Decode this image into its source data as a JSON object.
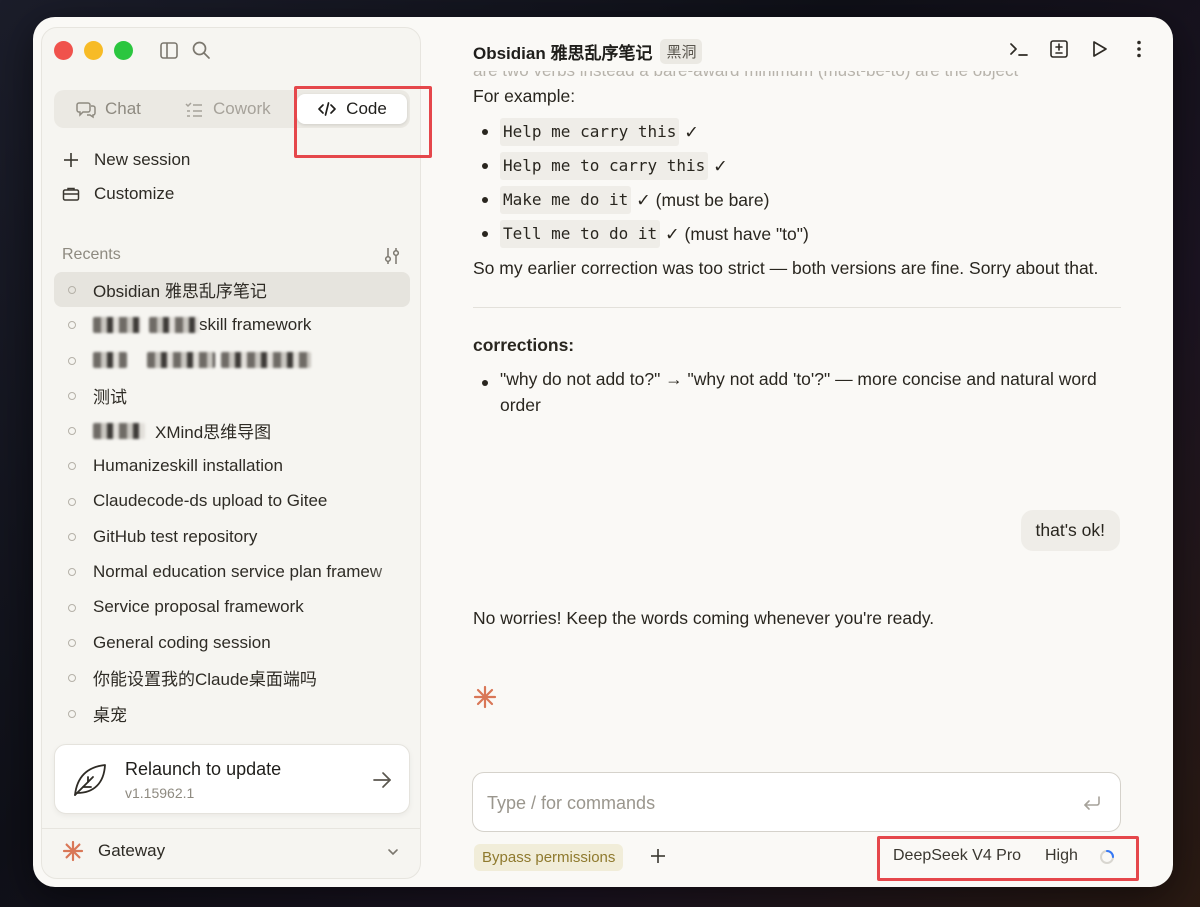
{
  "sidebar": {
    "tabs": [
      {
        "label": "Chat",
        "icon": "chat-bubbles-icon"
      },
      {
        "label": "Cowork",
        "icon": "checklist-icon"
      },
      {
        "label": "Code",
        "icon": "code-brackets-icon",
        "active": true
      }
    ],
    "new_session": "New session",
    "customize": "Customize",
    "recents_header": "Recents",
    "recents": [
      {
        "label": "Obsidian 雅思乱序笔记",
        "active": true
      },
      {
        "label": "skill framework"
      },
      {
        "label": ""
      },
      {
        "label": "测试"
      },
      {
        "label": "XMind思维导图"
      },
      {
        "label": "Humanizeskill installation"
      },
      {
        "label": "Claudecode-ds upload to Gitee"
      },
      {
        "label": "GitHub test repository"
      },
      {
        "label": "Normal education service plan framew"
      },
      {
        "label": "Service proposal framework"
      },
      {
        "label": "General coding session"
      },
      {
        "label": "你能设置我的Claude桌面端吗"
      },
      {
        "label": "桌宠"
      }
    ],
    "update": {
      "title": "Relaunch to update",
      "version": "v1.15962.1"
    },
    "gateway": "Gateway"
  },
  "header": {
    "title": "Obsidian 雅思乱序笔记",
    "badge": "黑洞"
  },
  "conversation": {
    "cut_text": "are two verbs instead a bare-award minimum (must-be-to) are the object",
    "intro": "For example:",
    "examples": [
      {
        "code": "Help me carry this",
        "note": "✓"
      },
      {
        "code": "Help me to carry this",
        "note": "✓"
      },
      {
        "code": "Make me do it",
        "note": "✓ (must be bare)"
      },
      {
        "code": "Tell me to do it",
        "note": "✓ (must have \"to\")"
      }
    ],
    "summary": "So my earlier correction was too strict — both versions are fine. Sorry about that.",
    "corrections_header": "corrections:",
    "corrections": [
      "\"why do not add to?\" → \"why not add 'to'?\" — more concise and natural word order"
    ],
    "user_message": "that's ok!",
    "assistant_reply": "No worries! Keep the words coming whenever you're ready."
  },
  "composer": {
    "placeholder": "Type / for commands",
    "permissions_label": "Bypass permissions",
    "model": "DeepSeek V4 Pro",
    "effort": "High"
  },
  "colors": {
    "accent": "#d97757",
    "highlight": "#e5474b",
    "background": "#faf9f6"
  }
}
